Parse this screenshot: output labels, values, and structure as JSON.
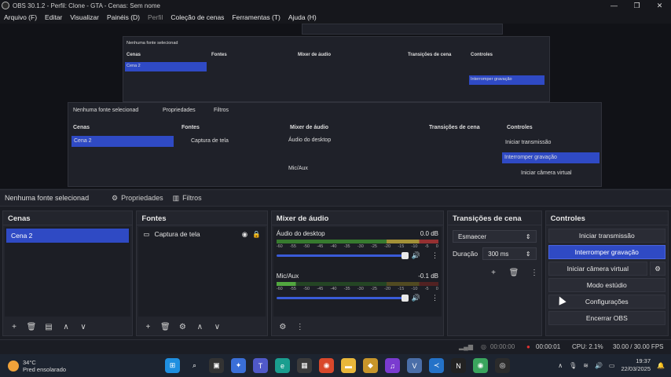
{
  "window": {
    "title": "OBS 30.1.2 - Perfil: Clone - GTA - Cenas: Sem nome",
    "controls": [
      "—",
      "❐",
      "✕"
    ]
  },
  "menu": [
    "Arquivo (F)",
    "Editar",
    "Visualizar",
    "Painéis (D)",
    "Perfil",
    "Coleção de cenas",
    "Ferramentas (T)",
    "Ajuda (H)"
  ],
  "source_bar": {
    "no_source": "Nenhuma fonte selecionad",
    "properties": "Propriedades",
    "filters": "Filtros"
  },
  "scenes": {
    "title": "Cenas",
    "items": [
      "Cena 2"
    ]
  },
  "sources": {
    "title": "Fontes",
    "items": [
      "Captura de tela"
    ]
  },
  "mixer": {
    "title": "Mixer de áudio",
    "channels": [
      {
        "name": "Áudio do desktop",
        "db": "0.0 dB"
      },
      {
        "name": "Mic/Aux",
        "db": "-0.1 dB"
      }
    ],
    "ticks": [
      "-60",
      "-55",
      "-50",
      "-45",
      "-40",
      "-35",
      "-30",
      "-25",
      "-20",
      "-15",
      "-10",
      "-5",
      "0"
    ]
  },
  "transitions": {
    "title": "Transições de cena",
    "type": "Esmaecer",
    "duration_label": "Duração",
    "duration": "300 ms"
  },
  "controls": {
    "title": "Controles",
    "buttons": [
      "Iniciar transmissão",
      "Interromper gravação",
      "Iniciar câmera virtual",
      "Modo estúdio",
      "Configurações",
      "Encerrar OBS"
    ]
  },
  "status": {
    "stream_time": "00:00:00",
    "rec_time": "00:00:01",
    "cpu": "CPU: 2.1%",
    "fps": "30.00 / 30.00 FPS"
  },
  "taskbar": {
    "temp": "34°C",
    "weather": "Pred ensolarado",
    "time": "19:37",
    "date": "22/03/2025"
  }
}
